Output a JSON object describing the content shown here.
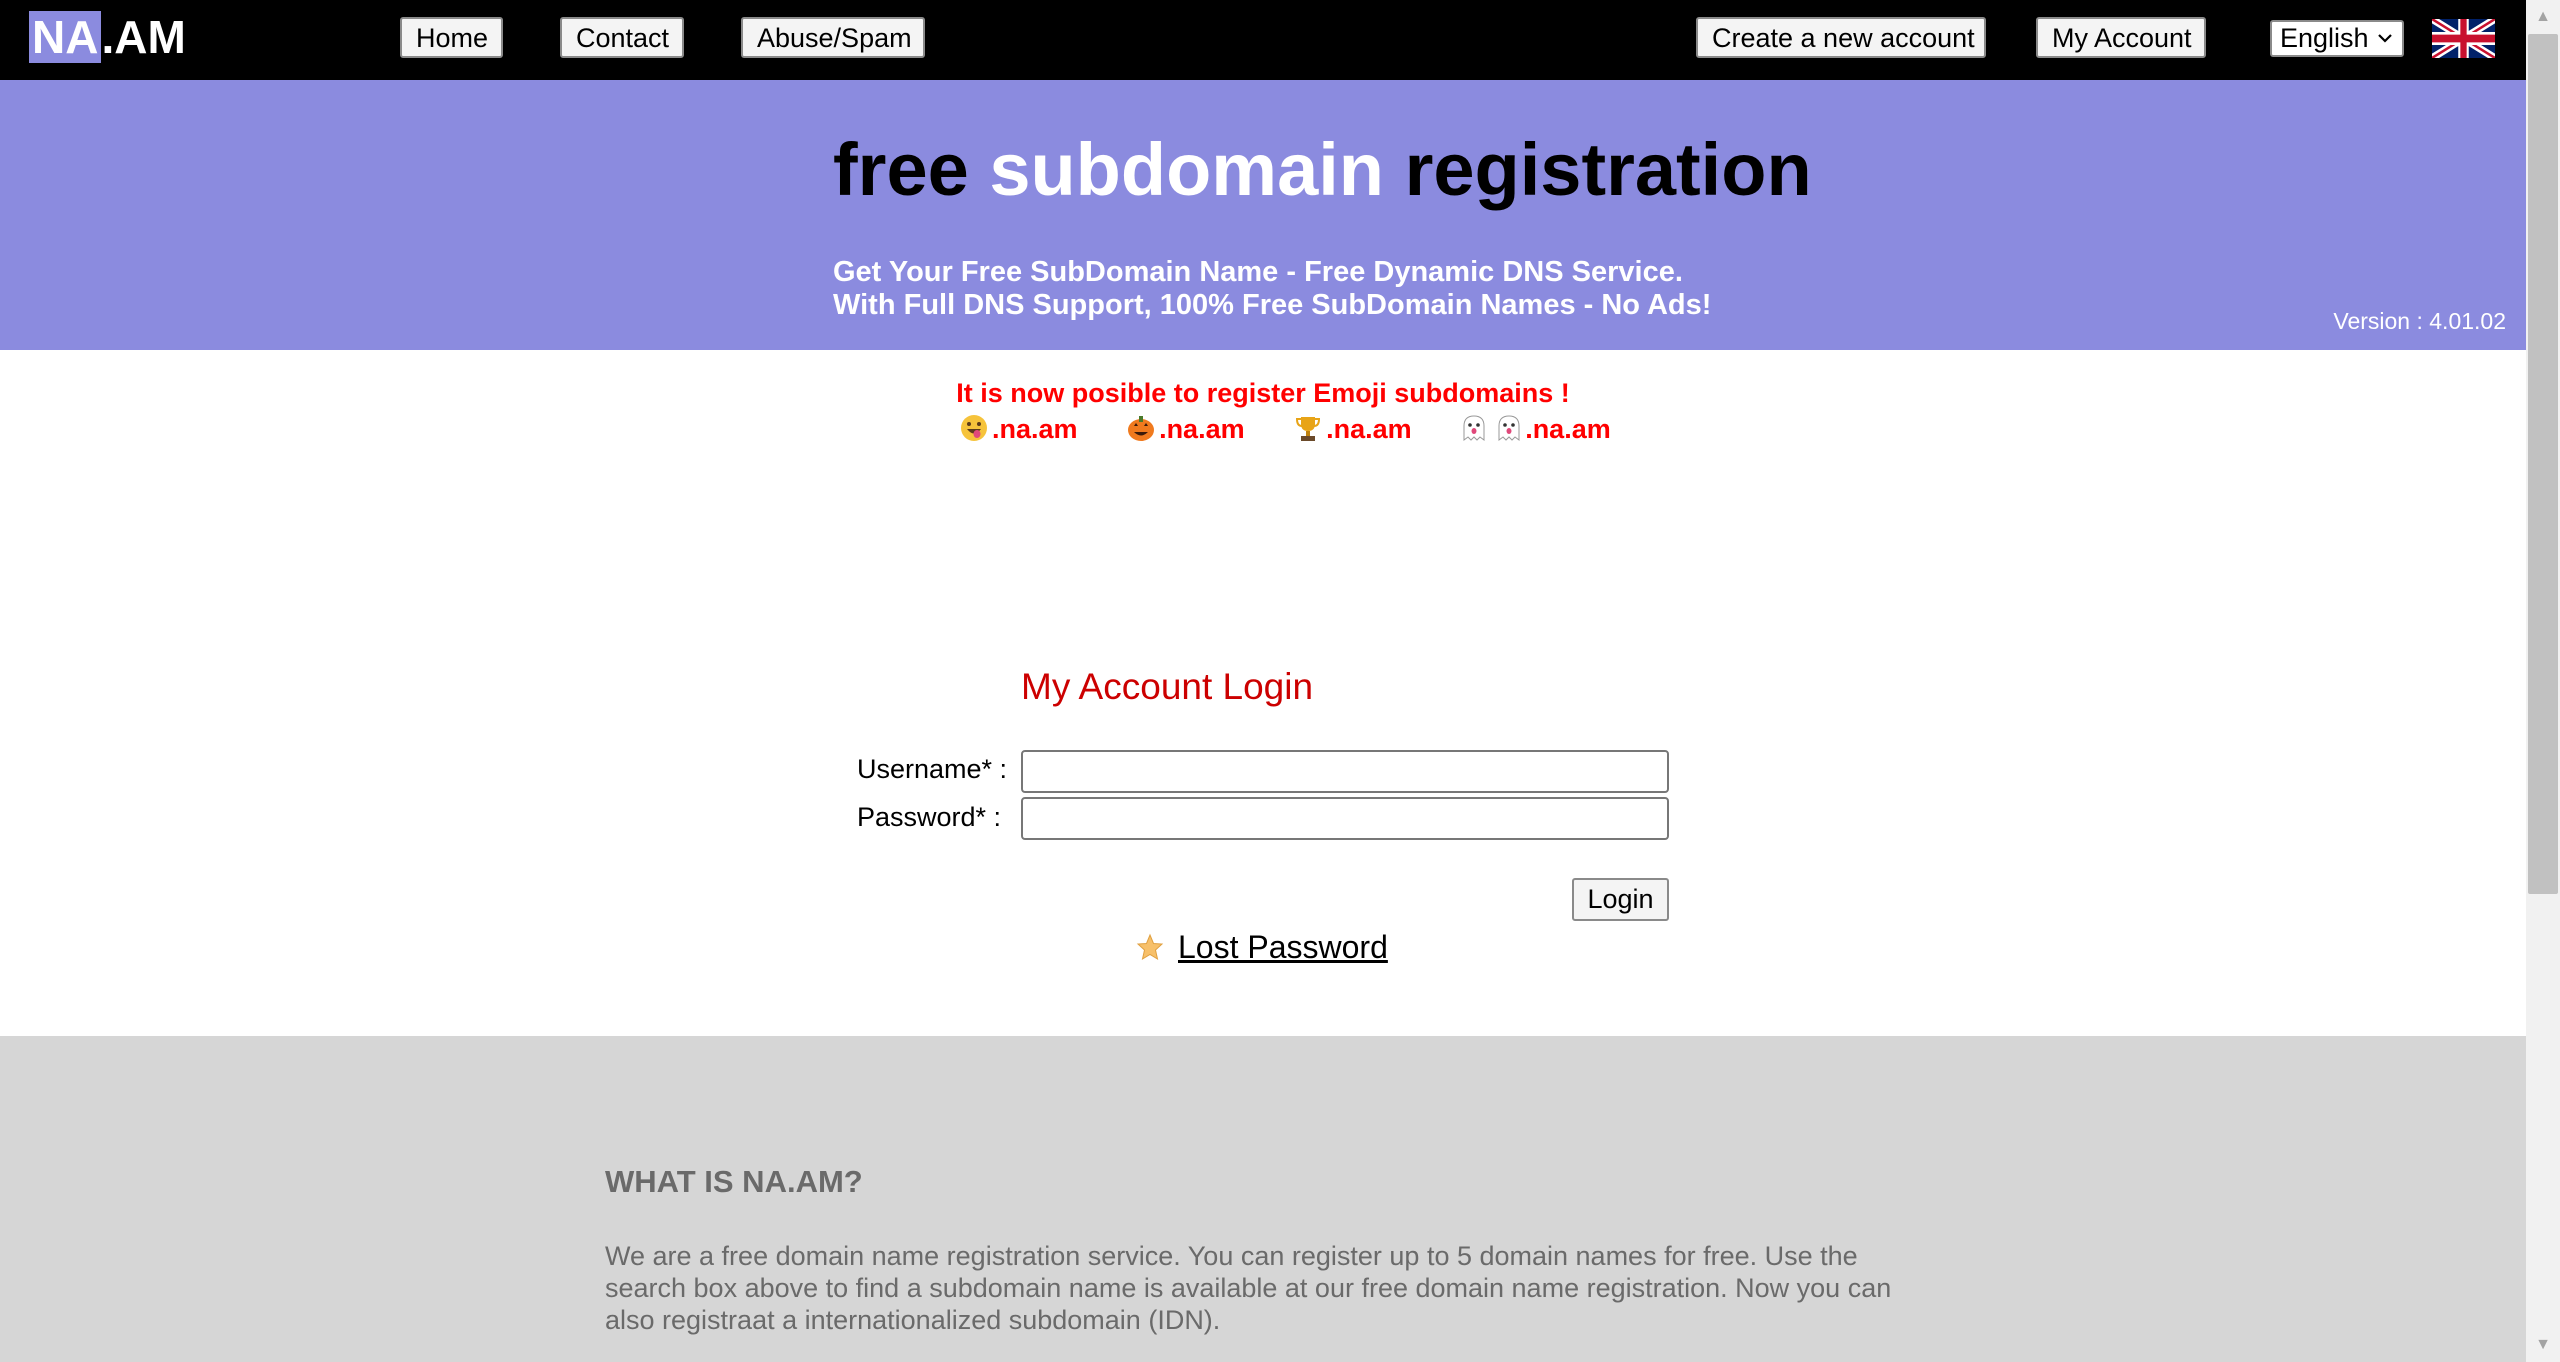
{
  "header": {
    "logo_highlight": "NA",
    "logo_rest": ".AM",
    "nav": {
      "home": "Home",
      "contact": "Contact",
      "abuse": "Abuse/Spam",
      "create_account": "Create a new account",
      "my_account": "My Account"
    },
    "language": "English",
    "flag_icon": "uk-flag-icon"
  },
  "hero": {
    "title_part1": "free",
    "title_part2": "subdomain",
    "title_part3": "registration",
    "subtitle_line1": "Get Your Free SubDomain Name - Free Dynamic DNS Service.",
    "subtitle_line2": "With Full DNS Support, 100% Free SubDomain Names - No Ads!",
    "version": "Version : 4.01.02",
    "background_color": "#8b8bdf"
  },
  "notice": {
    "text": "It is now posible to register Emoji subdomains !",
    "emoji_domains": [
      {
        "icon": "tongue-face-emoji",
        "suffix": ".na.am"
      },
      {
        "icon": "jack-o-lantern-emoji",
        "suffix": ".na.am"
      },
      {
        "icon": "trophy-emoji",
        "suffix": ".na.am"
      },
      {
        "icon": "ghost-emoji",
        "suffix": ".na.am"
      }
    ],
    "color": "#ff0000"
  },
  "login": {
    "title": "My Account Login",
    "username_label": "Username* :",
    "password_label": "Password* :",
    "username_value": "",
    "password_value": "",
    "submit_label": "Login",
    "lost_password": "Lost Password",
    "lost_icon": "star-icon"
  },
  "info": {
    "heading": "WHAT IS NA.AM?",
    "text": "We are a free domain name registration service. You can register up to 5 domain names for free. Use the search box above to find a subdomain name is available at our free domain name registration. Now you can also registraat a internationalized subdomain (IDN)."
  }
}
